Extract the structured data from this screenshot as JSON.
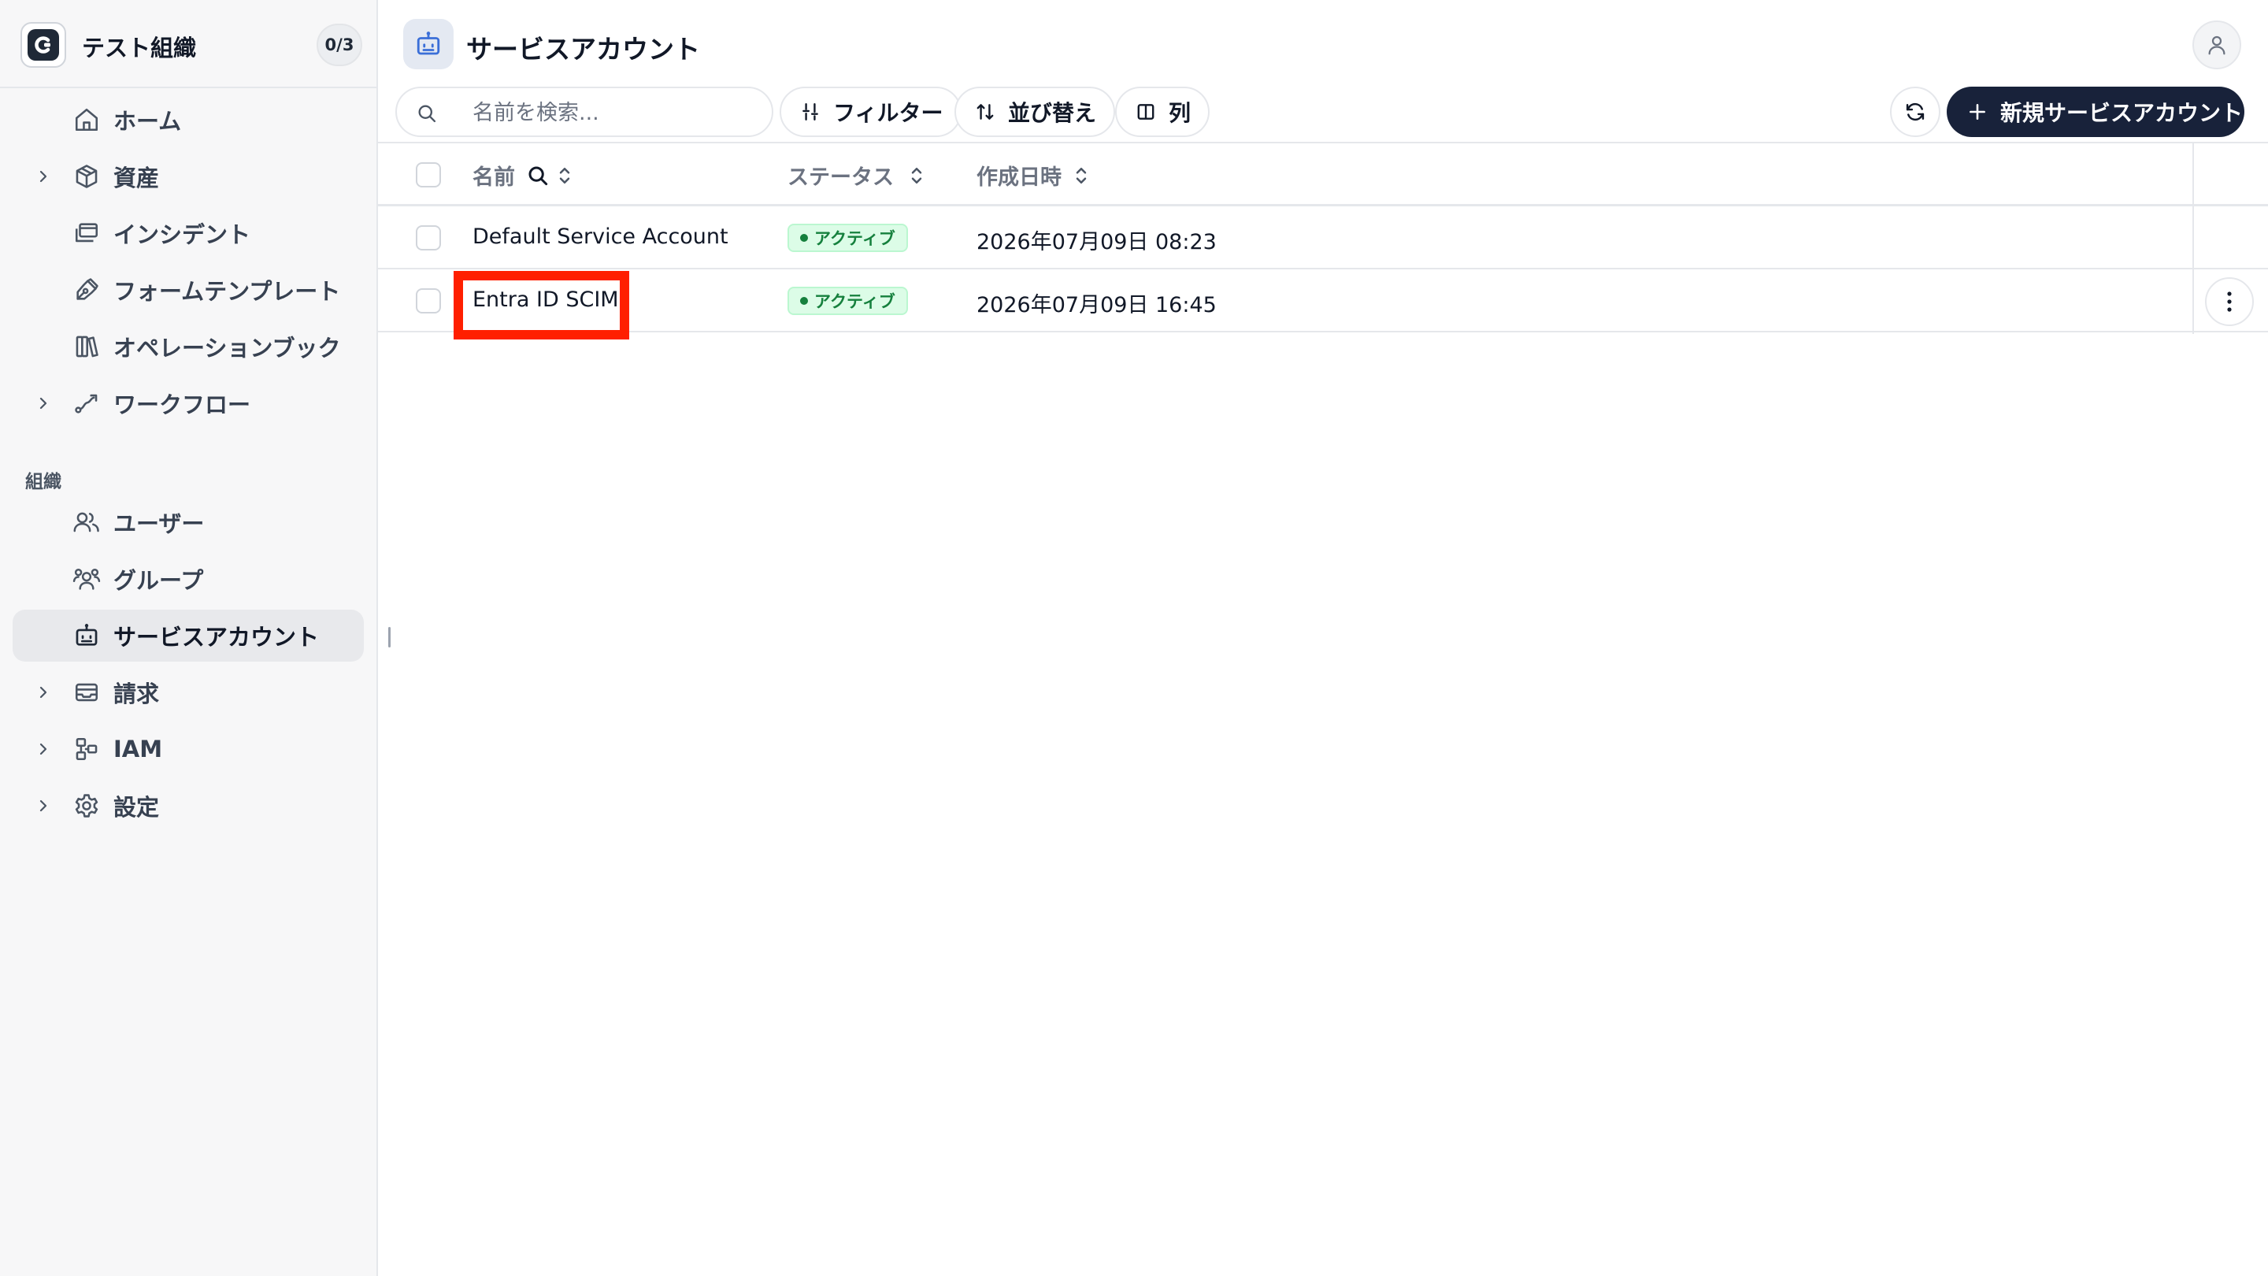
{
  "org": {
    "name": "テスト組織",
    "counter": "0/3"
  },
  "sidebar": {
    "items": [
      {
        "label": "ホーム",
        "icon": "home-icon",
        "expandable": false
      },
      {
        "label": "資産",
        "icon": "box-icon",
        "expandable": true
      },
      {
        "label": "インシデント",
        "icon": "windows-icon",
        "expandable": false
      },
      {
        "label": "フォームテンプレート",
        "icon": "pen-tool-icon",
        "expandable": false
      },
      {
        "label": "オペレーションブック",
        "icon": "library-icon",
        "expandable": false
      },
      {
        "label": "ワークフロー",
        "icon": "workflow-icon",
        "expandable": true
      }
    ],
    "section_label": "組織",
    "org_items": [
      {
        "label": "ユーザー",
        "icon": "users-icon",
        "expandable": false
      },
      {
        "label": "グループ",
        "icon": "group-icon",
        "expandable": false
      },
      {
        "label": "サービスアカウント",
        "icon": "bot-icon",
        "expandable": false,
        "active": true
      },
      {
        "label": "請求",
        "icon": "wallet-icon",
        "expandable": true
      },
      {
        "label": "IAM",
        "icon": "iam-icon",
        "expandable": true
      },
      {
        "label": "設定",
        "icon": "gear-icon",
        "expandable": true
      }
    ]
  },
  "page": {
    "title": "サービスアカウント",
    "icon": "bot-icon"
  },
  "toolbar": {
    "search_placeholder": "名前を検索...",
    "filter_label": "フィルター",
    "sort_label": "並び替え",
    "columns_label": "列",
    "new_label": "新規サービスアカウント"
  },
  "table": {
    "headers": {
      "name": "名前",
      "status": "ステータス",
      "created": "作成日時"
    },
    "rows": [
      {
        "name": "Default Service Account",
        "status": "アクティブ",
        "created": "2026年07月09日 08:23"
      },
      {
        "name": "Entra ID SCIM",
        "status": "アクティブ",
        "created": "2026年07月09日 16:45"
      }
    ]
  },
  "colors": {
    "accent": "#18223a",
    "status_active": "#15803d",
    "highlight": "#ff1f00"
  }
}
